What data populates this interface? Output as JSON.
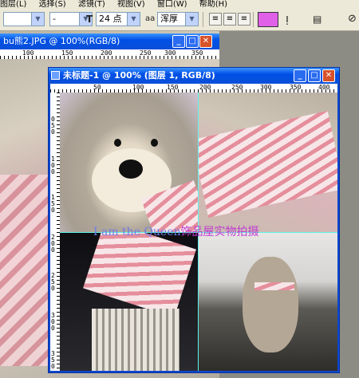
{
  "menu": [
    "图层(L)",
    "选择(S)",
    "滤镜(T)",
    "视图(V)",
    "窗口(W)",
    "帮助(H)"
  ],
  "toolbar": {
    "font_family_value": "",
    "font_style_value": "-",
    "font_size_value": "24 点",
    "antialias_label": "aa",
    "antialias_value": "浑厚",
    "text_color": "#e060e8"
  },
  "bg_window": {
    "title": "bu熊2.JPG @ 100%(RGB/8)",
    "ruler_numbers": [
      "100",
      "150",
      "200",
      "250",
      "300",
      "350"
    ]
  },
  "main_window": {
    "title": "未标题-1 @ 100% (图层 1, RGB/8)",
    "ruler_numbers_h": [
      "50",
      "100",
      "150",
      "200",
      "250",
      "300",
      "350",
      "400"
    ],
    "ruler_numbers_v": [
      "0",
      "5",
      "0",
      "1",
      "0",
      "0",
      "1",
      "5",
      "0",
      "2",
      "0",
      "0",
      "2",
      "5",
      "0",
      "3",
      "0",
      "0",
      "3",
      "5",
      "0"
    ]
  },
  "overlay_text": {
    "latin": "I am the Queen",
    "cjk": "饰品屋实物拍摄"
  },
  "colors": {
    "title_bar": "#0a4fd8",
    "guide": "#5ef3ea",
    "overlay_latin": "#6f7ce6",
    "overlay_cjk": "#c03cd0"
  }
}
